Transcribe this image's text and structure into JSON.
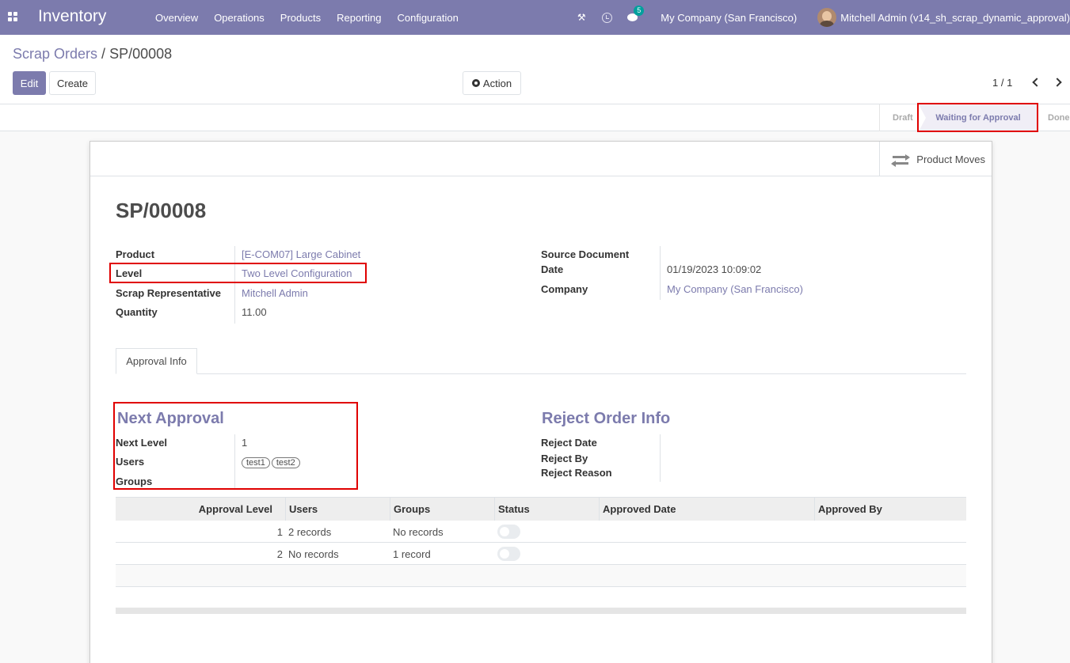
{
  "navbar": {
    "app_name": "Inventory",
    "menu": [
      "Overview",
      "Operations",
      "Products",
      "Reporting",
      "Configuration"
    ],
    "chat_badge": "5",
    "company": "My Company (San Francisco)",
    "user": "Mitchell Admin (v14_sh_scrap_dynamic_approval)"
  },
  "control": {
    "breadcrumb_parent": "Scrap Orders",
    "breadcrumb_sep": " / ",
    "breadcrumb_current": "SP/00008",
    "edit_label": "Edit",
    "create_label": "Create",
    "action_label": "Action",
    "pager": "1 / 1"
  },
  "statusbar": {
    "stages": [
      "Draft",
      "Waiting for Approval",
      "Done"
    ],
    "active": "Waiting for Approval"
  },
  "form": {
    "smart_button": "Product Moves",
    "title": "SP/00008",
    "left": [
      {
        "label": "Product",
        "value": "[E-COM07] Large Cabinet"
      },
      {
        "label": "Level",
        "value": "Two Level Configuration"
      },
      {
        "label": "Scrap Representative",
        "value": "Mitchell Admin"
      },
      {
        "label": "Quantity",
        "value": "11.00"
      }
    ],
    "right": [
      {
        "label": "Source Document",
        "value": ""
      },
      {
        "label": "Date",
        "value": "01/19/2023 10:09:02"
      },
      {
        "label": "Company",
        "value": "My Company (San Francisco)"
      }
    ],
    "tab": "Approval Info",
    "next_approval": {
      "heading": "Next Approval",
      "next_level_label": "Next Level",
      "next_level_value": "1",
      "users_label": "Users",
      "users": [
        "test1",
        "test2"
      ],
      "groups_label": "Groups"
    },
    "reject_info": {
      "heading": "Reject Order Info",
      "labels": [
        "Reject Date",
        "Reject By",
        "Reject Reason"
      ]
    },
    "table": {
      "headers": [
        "Approval Level",
        "Users",
        "Groups",
        "Status",
        "Approved Date",
        "Approved By"
      ],
      "rows": [
        {
          "level": "1",
          "users": "2 records",
          "groups": "No records"
        },
        {
          "level": "2",
          "users": "No records",
          "groups": "1 record"
        }
      ]
    }
  }
}
